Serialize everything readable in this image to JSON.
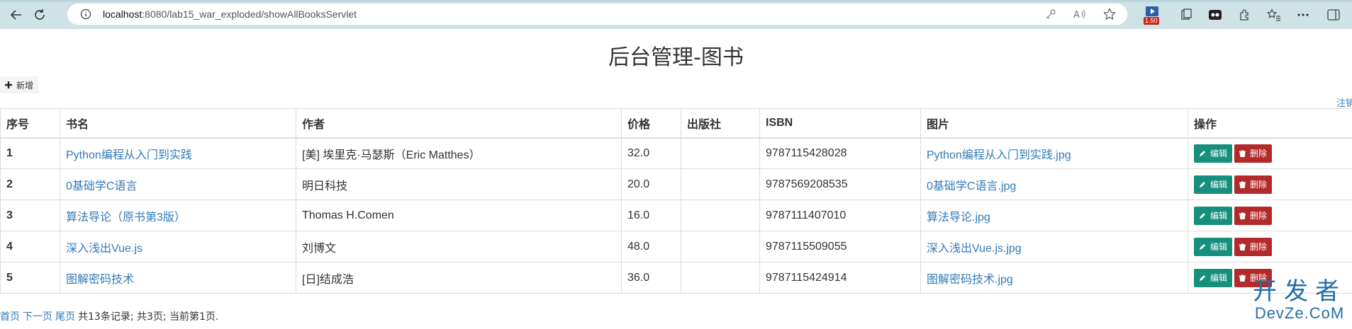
{
  "browser": {
    "url_host": "localhost",
    "url_rest": ":8080/lab15_war_exploded/showAllBooksServlet",
    "badge_count": "1.50"
  },
  "page": {
    "title": "后台管理-图书",
    "add_label": "新增",
    "logout_label": "注销"
  },
  "table": {
    "headers": [
      "序号",
      "书名",
      "作者",
      "价格",
      "出版社",
      "ISBN",
      "图片",
      "操作"
    ],
    "rows": [
      {
        "no": "1",
        "title": "Python编程从入门到实践",
        "author": "[美] 埃里克·马瑟斯（Eric Matthes）",
        "price": "32.0",
        "publisher": "",
        "isbn": "9787115428028",
        "image": "Python编程从入门到实践.jpg"
      },
      {
        "no": "2",
        "title": "0基础学C语言",
        "author": "明日科技",
        "price": "20.0",
        "publisher": "",
        "isbn": "9787569208535",
        "image": "0基础学C语言.jpg"
      },
      {
        "no": "3",
        "title": "算法导论（原书第3版）",
        "author": "Thomas H.Comen",
        "price": "16.0",
        "publisher": "",
        "isbn": "9787111407010",
        "image": "算法导论.jpg"
      },
      {
        "no": "4",
        "title": "深入浅出Vue.js",
        "author": "刘博文",
        "price": "48.0",
        "publisher": "",
        "isbn": "9787115509055",
        "image": "深入浅出Vue.js.jpg"
      },
      {
        "no": "5",
        "title": "图解密码技术",
        "author": "[日]结成浩",
        "price": "36.0",
        "publisher": "",
        "isbn": "9787115424914",
        "image": "图解密码技术.jpg"
      }
    ],
    "edit_label": "编辑",
    "delete_label": "删除"
  },
  "pager": {
    "first": "首页",
    "next": "下一页",
    "last": "尾页",
    "summary": "共13条记录; 共3页; 当前第1页."
  },
  "watermark": {
    "cn": "开发者",
    "en": "DevZe.CoM"
  }
}
